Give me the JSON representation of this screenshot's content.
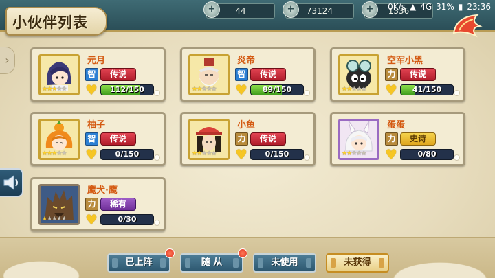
{
  "header": {
    "title": "小伙伴列表",
    "resources": [
      {
        "icon": "stamina-icon",
        "value": "44"
      },
      {
        "icon": "coin-icon",
        "value": "73124"
      },
      {
        "icon": "gem-icon",
        "value": "1336"
      }
    ]
  },
  "status_bar": {
    "speed": "0K/s",
    "network": "4G",
    "battery": "31%",
    "time": "23:36"
  },
  "cards": [
    {
      "name": "元月",
      "attr": "智",
      "attr_type": "zhi",
      "rarity": "传说",
      "rarity_type": "legend",
      "progress_text": "112/150",
      "progress": 0.747,
      "stars": 3,
      "frame": "gold",
      "portrait_icon": "ninja-girl-portrait-icon"
    },
    {
      "name": "炎帝",
      "attr": "智",
      "attr_type": "zhi",
      "rarity": "传说",
      "rarity_type": "legend",
      "progress_text": "89/150",
      "progress": 0.593,
      "stars": 2,
      "frame": "gold",
      "portrait_icon": "old-sage-portrait-icon"
    },
    {
      "name": "空军小黑",
      "attr": "力",
      "attr_type": "li",
      "rarity": "传说",
      "rarity_type": "legend",
      "progress_text": "41/150",
      "progress": 0.273,
      "stars": 2,
      "frame": "gold",
      "portrait_icon": "goggle-pilot-portrait-icon"
    },
    {
      "name": "柚子",
      "attr": "智",
      "attr_type": "zhi",
      "rarity": "传说",
      "rarity_type": "legend",
      "progress_text": "0/150",
      "progress": 0,
      "stars": 3,
      "frame": "gold",
      "portrait_icon": "orange-girl-portrait-icon"
    },
    {
      "name": "小鱼",
      "attr": "力",
      "attr_type": "li",
      "rarity": "传说",
      "rarity_type": "legend",
      "progress_text": "0/150",
      "progress": 0,
      "stars": 2,
      "frame": "gold",
      "portrait_icon": "hat-boy-portrait-icon"
    },
    {
      "name": "蛋蛋",
      "attr": "力",
      "attr_type": "li",
      "rarity": "史诗",
      "rarity_type": "epic",
      "progress_text": "0/80",
      "progress": 0,
      "stars": 2,
      "frame": "purple",
      "portrait_icon": "bunny-girl-portrait-icon"
    },
    {
      "name": "鹰犬·鹰",
      "attr": "力",
      "attr_type": "li",
      "rarity": "稀有",
      "rarity_type": "rare",
      "progress_text": "0/30",
      "progress": 0,
      "stars": 1,
      "frame": "brown",
      "portrait_icon": "wolf-beast-portrait-icon"
    }
  ],
  "tabs": [
    {
      "label": "已上阵",
      "active": false,
      "badge": true
    },
    {
      "label": "随 从",
      "active": false,
      "badge": true
    },
    {
      "label": "未使用",
      "active": false,
      "badge": false
    },
    {
      "label": "未获得",
      "active": true,
      "badge": false
    }
  ],
  "colors": {
    "name_text": "#d45a12",
    "legend": "#c82b39",
    "epic": "#e8b52b",
    "rare": "#8344ad",
    "progress_fill": "#5cbf2e"
  }
}
